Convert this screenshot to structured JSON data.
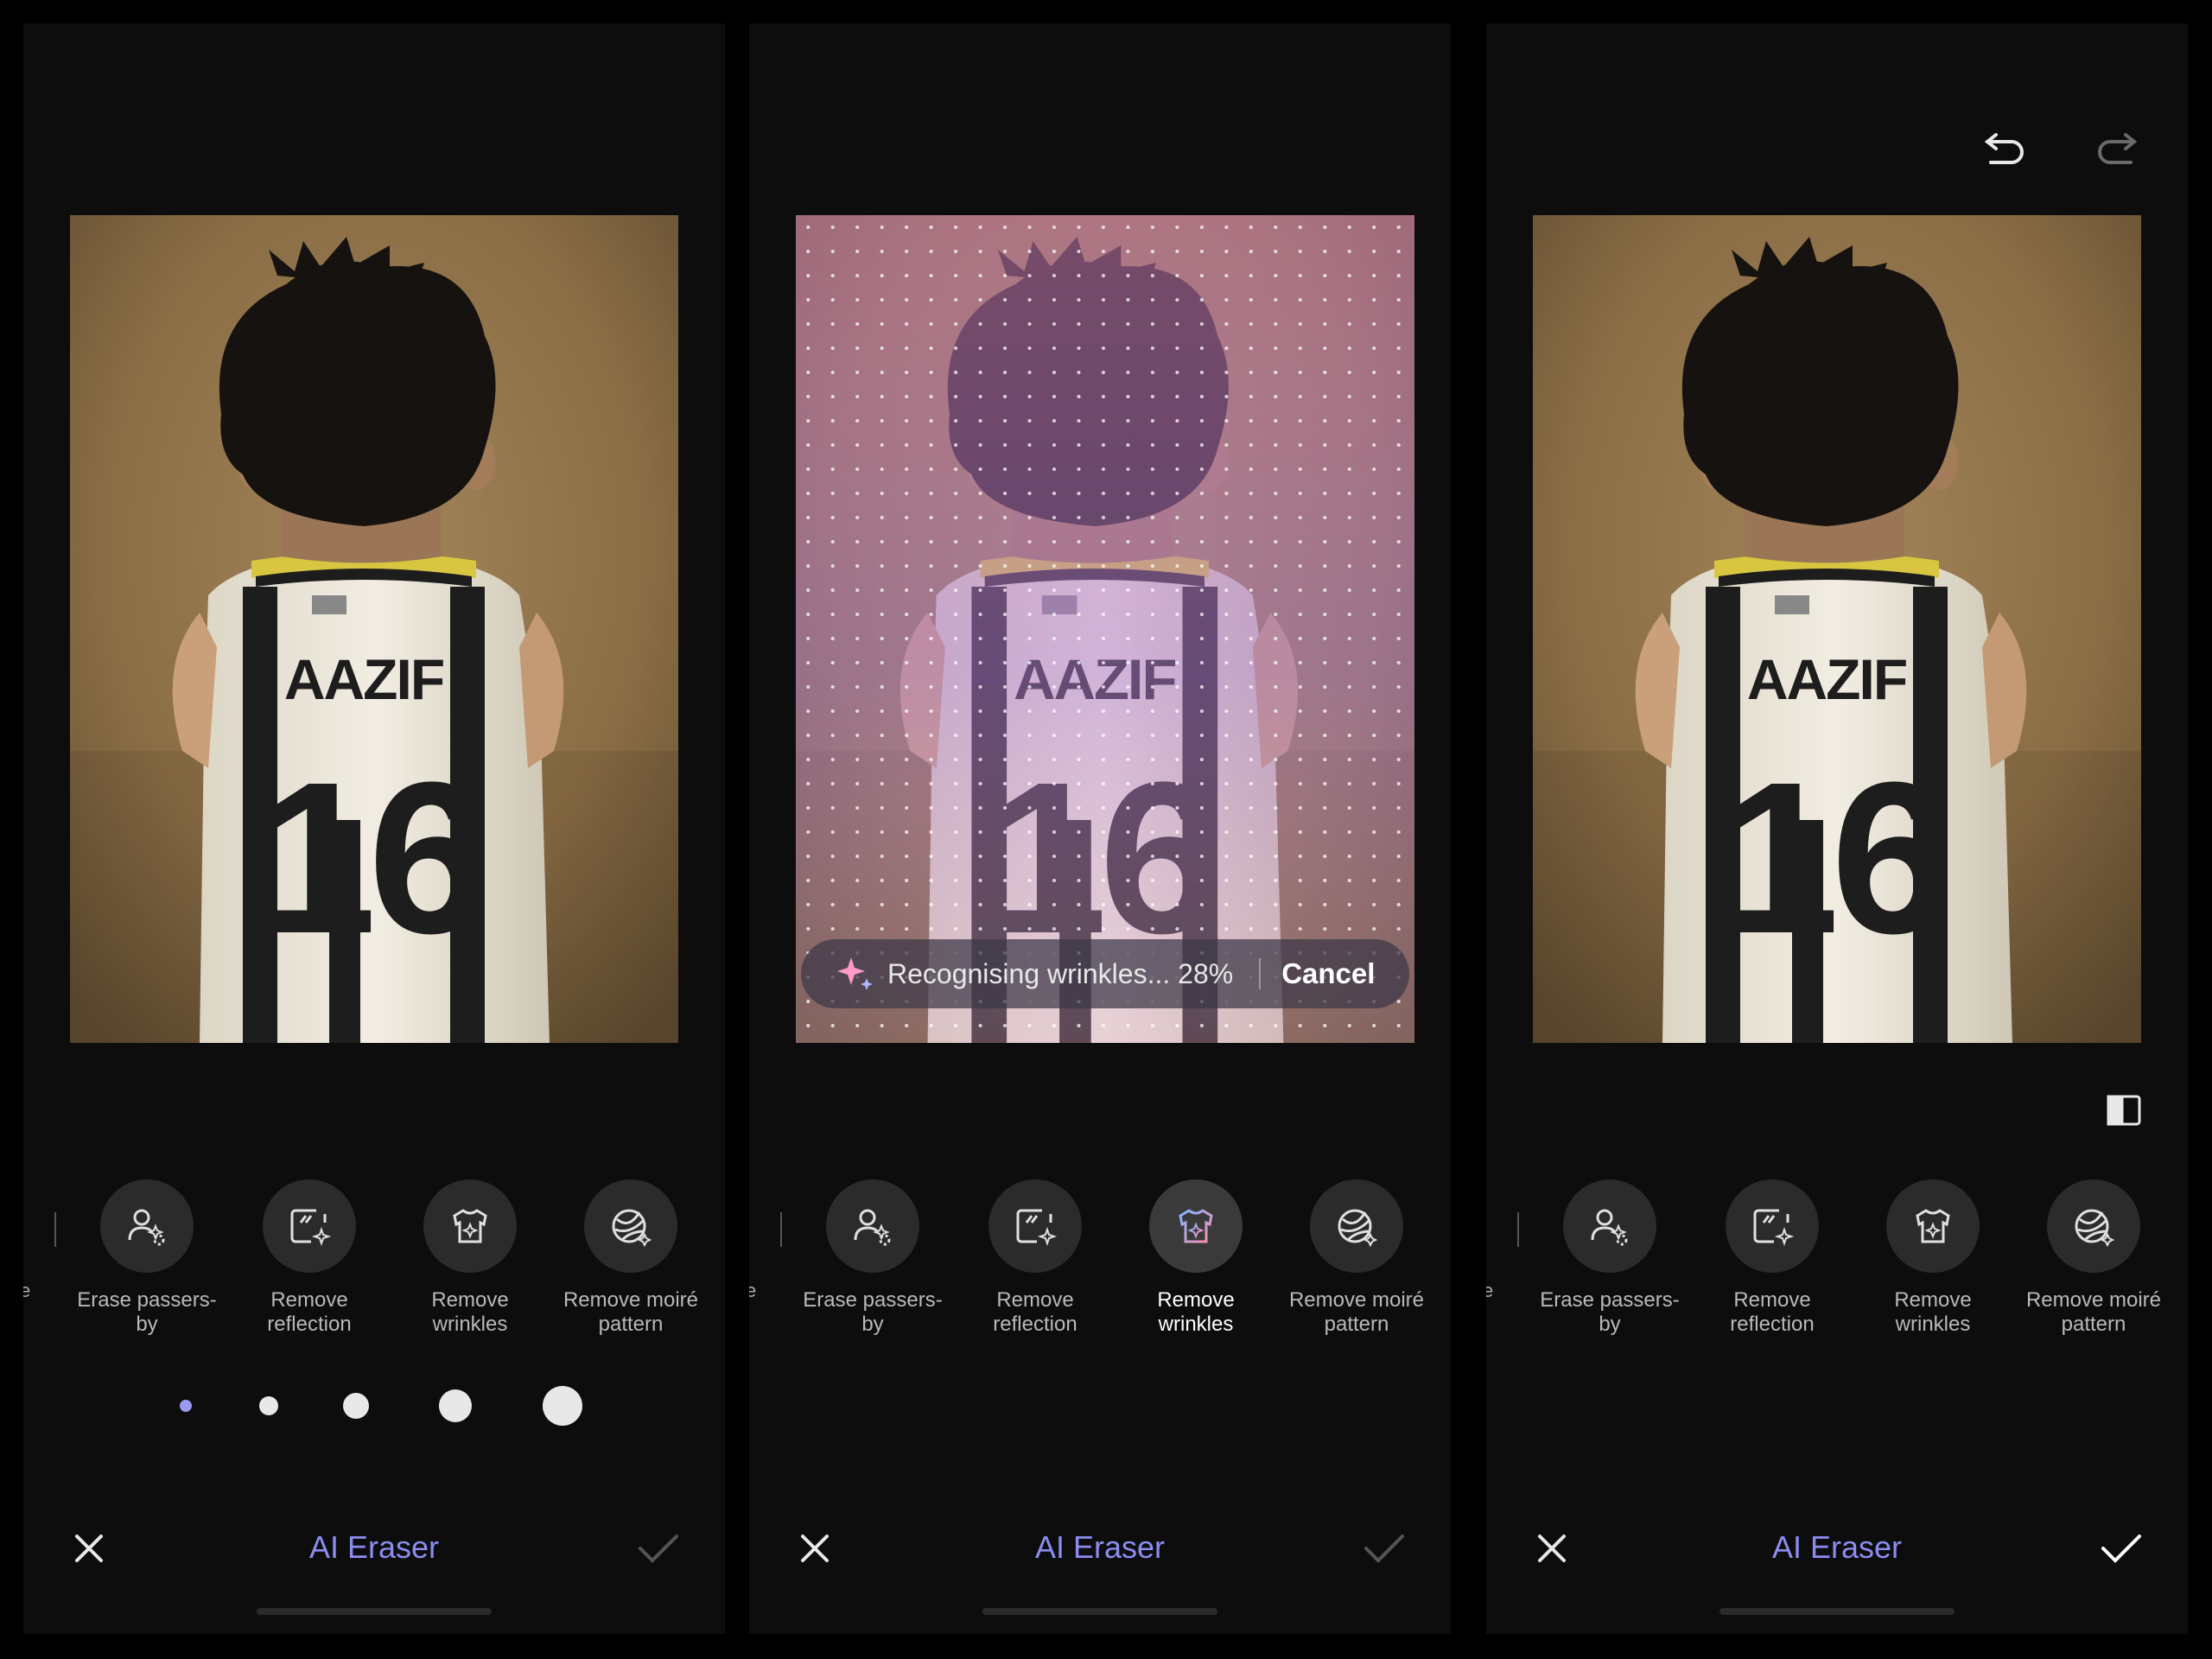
{
  "colors": {
    "title_accent": "#8c8cf0",
    "active_icon_gradient": [
      "#7fb6ff",
      "#ff8fb0"
    ]
  },
  "panels": [
    {
      "state": "initial",
      "tools": [
        {
          "label": "Erase passers-by",
          "icon": "person-sparkle-icon"
        },
        {
          "label": "Remove reflection",
          "icon": "reflection-icon"
        },
        {
          "label": "Remove wrinkles",
          "icon": "shirt-icon"
        },
        {
          "label": "Remove moiré pattern",
          "icon": "moire-icon"
        }
      ],
      "edge_label": "e",
      "brush_sizes": 5,
      "title": "AI Eraser"
    },
    {
      "state": "processing",
      "progress_text": "Recognising wrinkles... 28%",
      "progress": 0.28,
      "cancel_label": "Cancel",
      "active_tool": "Remove wrinkles",
      "tools": [
        {
          "label": "Erase passers-by",
          "icon": "person-sparkle-icon"
        },
        {
          "label": "Remove reflection",
          "icon": "reflection-icon"
        },
        {
          "label": "Remove wrinkles",
          "icon": "shirt-icon"
        },
        {
          "label": "Remove moiré pattern",
          "icon": "moire-icon"
        }
      ],
      "edge_label": "e",
      "title": "AI Eraser"
    },
    {
      "state": "done",
      "tools": [
        {
          "label": "Erase passers-by",
          "icon": "person-sparkle-icon"
        },
        {
          "label": "Remove reflection",
          "icon": "reflection-icon"
        },
        {
          "label": "Remove wrinkles",
          "icon": "shirt-icon"
        },
        {
          "label": "Remove moiré pattern",
          "icon": "moire-icon"
        }
      ],
      "edge_label": "e",
      "title": "AI Eraser"
    }
  ],
  "photo": {
    "jersey_name": "AAZIF",
    "jersey_number": "16"
  }
}
